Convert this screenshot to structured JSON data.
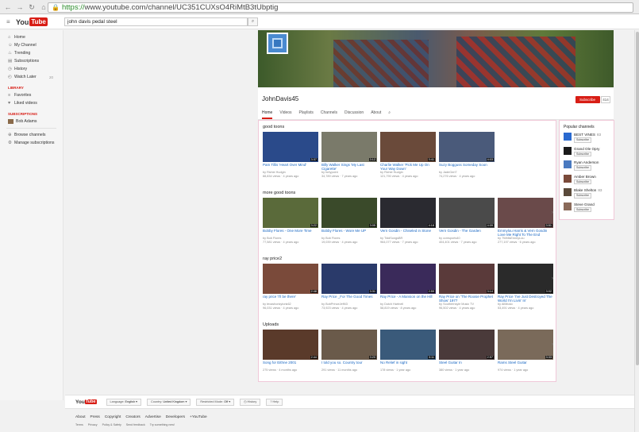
{
  "browser": {
    "url_scheme": "https://",
    "url_rest": "www.youtube.com/channel/UC351CUXsO4RiMtB3tUbptig"
  },
  "masthead": {
    "logo_you": "You",
    "logo_tube": "Tube",
    "search_value": "john davis pedal steel"
  },
  "sidebar": {
    "items": [
      {
        "icon": "home-icon",
        "glyph": "⌂",
        "label": "Home"
      },
      {
        "icon": "user-icon",
        "glyph": "☺",
        "label": "My Channel"
      },
      {
        "icon": "flame-icon",
        "glyph": "♨",
        "label": "Trending"
      },
      {
        "icon": "subscriptions-icon",
        "glyph": "▤",
        "label": "Subscriptions"
      },
      {
        "icon": "history-icon",
        "glyph": "◷",
        "label": "History"
      },
      {
        "icon": "clock-icon",
        "glyph": "◴",
        "label": "Watch Later",
        "count": "20"
      }
    ],
    "library_head": "LIBRARY",
    "library": [
      {
        "icon": "list-icon",
        "glyph": "≡",
        "label": "Favorites"
      },
      {
        "icon": "thumb-up-icon",
        "glyph": "♥",
        "label": "Liked videos"
      }
    ],
    "subs_head": "SUBSCRIPTIONS",
    "subs": [
      {
        "label": "Bob Adams"
      }
    ],
    "bottom": [
      {
        "icon": "add-circle-icon",
        "glyph": "⊕",
        "label": "Browse channels"
      },
      {
        "icon": "gear-icon",
        "glyph": "⚙",
        "label": "Manage subscriptions"
      }
    ]
  },
  "channel": {
    "name": "JohnDavis45",
    "subscribe_label": "Subscribe",
    "subscriber_count": "414",
    "tabs": [
      "Home",
      "Videos",
      "Playlists",
      "Channels",
      "Discussion",
      "About"
    ]
  },
  "shelves": [
    {
      "title": "good toons",
      "videos": [
        {
          "title": "Pam Tillis 'Heart Over Mind'",
          "author": "by Richie Hudgin",
          "meta": "88,834 views · 4 years ago",
          "dur": "3:37",
          "color": "#2a4a8a"
        },
        {
          "title": "Billy Walker Sings 'My Last Cigarette'",
          "author": "by fortypoint",
          "meta": "34,789 views · 7 years ago",
          "dur": "3:12",
          "color": "#7a7a6a"
        },
        {
          "title": "Charlie Walker 'Pick Me Up On Your Way Down'",
          "author": "by Richie Hudgin",
          "meta": "121,790 views · 4 years ago",
          "dur": "3:41",
          "color": "#6a4a3a"
        },
        {
          "title": "Suzy Bogguss Someday Soon",
          "author": "by JadeGerl7",
          "meta": "74,276 views · 4 years ago",
          "dur": "4:03",
          "color": "#4a5a7a"
        }
      ]
    },
    {
      "title": "more good toons",
      "videos": [
        {
          "title": "Bobby Flores - One More Time",
          "author": "by Bob Flores",
          "meta": "77,581 views · 4 years ago",
          "dur": "3:22",
          "color": "#5a6a3a"
        },
        {
          "title": "Bobby Flores - Wore Me UP",
          "author": "by Bob Flores",
          "meta": "19,039 views · 4 years ago",
          "dur": "3:05",
          "color": "#3a4a2a"
        },
        {
          "title": "Vern Gosdin - Chiseled in Stone",
          "author": "by TiddSongsBR",
          "meta": "964,077 views · 7 years ago",
          "dur": "4:18",
          "color": "#2a2a30"
        },
        {
          "title": "Vern Gosdin - The Garden",
          "author": "by ccmsports40",
          "meta": "404,401 views · 7 years ago",
          "dur": "4:09",
          "color": "#4a4a4a"
        },
        {
          "title": "Emmylou Harris & Vern Gosdin Love Me Right To The End",
          "author": "by 7WellsEmmyLou",
          "meta": "277,197 views · 6 years ago",
          "dur": "3:51",
          "color": "#6a4a4a"
        }
      ]
    },
    {
      "title": "ray price2",
      "videos": [
        {
          "title": "ray price 'i'll be there'",
          "author": "by texashonkytonk62",
          "meta": "96,031 views · 4 years ago",
          "dur": "2:48",
          "color": "#7a4a3a"
        },
        {
          "title": "Ray Price _For The Good Times",
          "author": "by BobPrinceJeff43",
          "meta": "73,923 views · 4 years ago",
          "dur": "3:31",
          "color": "#2a3a6a"
        },
        {
          "title": "Ray Price - A Mansion on the Hill",
          "author": "by Dutch Hartnell",
          "meta": "58,819 views · 8 years ago",
          "dur": "2:59",
          "color": "#3a2a5a"
        },
        {
          "title": "Ray Price on 'The Roosie Prophet Show' 1977",
          "author": "by Southernsyle Music TV",
          "meta": "96,502 views · 4 years ago",
          "dur": "3:14",
          "color": "#5a3a3a"
        },
        {
          "title": "Ray Price 'I've Just Destroyed The World I'm Livin' In'",
          "author": "by AllMusic",
          "meta": "53,491 views · 4 years ago",
          "dur": "3:02",
          "color": "#2a2a2a"
        }
      ]
    },
    {
      "title": "Uploads",
      "videos": [
        {
          "title": "Song for Eithne 2001",
          "author": "",
          "meta": "275 views · 4 months ago",
          "dur": "2:44",
          "color": "#5a3a2a"
        },
        {
          "title": "I told you so. Country tour",
          "author": "",
          "meta": "291 views · 11 months ago",
          "dur": "3:20",
          "color": "#6a5a4a"
        },
        {
          "title": "No Relief in sight",
          "author": "",
          "meta": "178 views · 1 year ago",
          "dur": "3:11",
          "color": "#3a5a7a"
        },
        {
          "title": "Steel Guitar In",
          "author": "",
          "meta": "380 views · 1 year ago",
          "dur": "2:57",
          "color": "#4a3a3a"
        },
        {
          "title": "Rams Steel Guitar",
          "author": "",
          "meta": "974 views · 1 year ago",
          "dur": "3:33",
          "color": "#7a6a5a"
        }
      ]
    }
  ],
  "popular": {
    "head": "Popular channels",
    "subscribe_label": "Subscribe",
    "channels": [
      {
        "name": "BEST VINES",
        "extra": "83",
        "color": "#2a6ad0"
      },
      {
        "name": "Grand Ole Opry",
        "extra": "",
        "color": "#1a1a1a"
      },
      {
        "name": "Ryan Anderson",
        "extra": "",
        "color": "#4a7ac0"
      },
      {
        "name": "Amber Brown",
        "extra": "",
        "color": "#7a4a3a"
      },
      {
        "name": "Blake Shelton",
        "extra": "83",
        "color": "#5a4a3a"
      },
      {
        "name": "Steve Grand",
        "extra": "",
        "color": "#8a6a5a"
      }
    ]
  },
  "footer": {
    "language_label": "Language:",
    "language_value": "English",
    "country_label": "Country:",
    "country_value": "United Kingdom",
    "restricted_label": "Restricted Mode:",
    "restricted_value": "Off",
    "history_label": "History",
    "help_label": "Help",
    "links": [
      "About",
      "Press",
      "Copyright",
      "Creators",
      "Advertise",
      "Developers",
      "+YouTube"
    ],
    "small_links": [
      "Terms",
      "Privacy",
      "Policy & Safety",
      "Send feedback",
      "Try something new!"
    ]
  }
}
